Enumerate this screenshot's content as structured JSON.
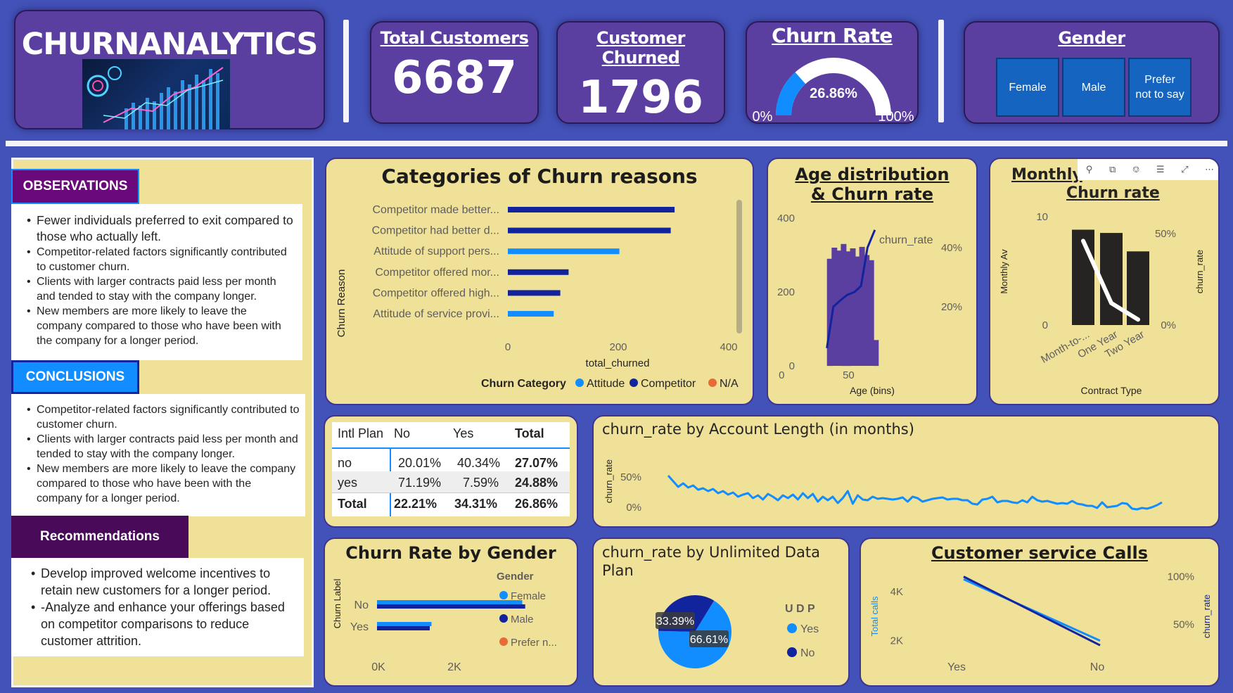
{
  "brand": {
    "title": "CHURNANALYTICS",
    "image_icon": "analytics-dashboard-image"
  },
  "kpis": {
    "total_customers": {
      "label": "Total Customers",
      "value": "6687"
    },
    "customer_churned": {
      "label": "Customer Churned",
      "value": "1796"
    },
    "churn_rate": {
      "label": "Churn Rate",
      "value": "26.86%",
      "fraction": 0.2686,
      "min_label": "0%",
      "max_label": "100%"
    },
    "gender": {
      "label": "Gender",
      "options": [
        "Female",
        "Male",
        "Prefer not to say"
      ]
    }
  },
  "notes": {
    "observations": {
      "label": "OBSERVATIONS",
      "items": [
        "Fewer individuals preferred to exit compared to those who actually left.",
        "Competitor-related factors significantly contributed to customer churn.",
        "Clients with larger contracts paid less per month and tended to stay with the company longer.",
        "New members are more likely to leave the company compared to those who have been with the company for a longer period."
      ]
    },
    "conclusions": {
      "label": "CONCLUSIONS",
      "items": [
        "Competitor-related factors significantly contributed to customer churn.",
        "Clients with larger contracts paid less per month and tended to stay with the company longer.",
        "New members are more likely to leave the company compared to those who have been with the company for a longer period."
      ]
    },
    "recommendations": {
      "label": "Recommendations",
      "items": [
        "Develop improved welcome incentives to retain new customers for a longer period.",
        "-Analyze and enhance your offerings based on competitor comparisons to reduce customer attrition."
      ]
    }
  },
  "colors": {
    "page_bg": "#4352b8",
    "kpi_bg": "#5b3fa0",
    "card_bg": "#f0e199",
    "attitude": "#118dff",
    "competitor": "#12239e",
    "na": "#e66c37",
    "hist_bar": "#5b3fa0",
    "contract_bar": "#252423"
  },
  "visual_header_icons": [
    "pin-icon",
    "copy-icon",
    "bell-icon",
    "filter-icon",
    "focus-mode-icon",
    "more-options-icon"
  ],
  "matrix": {
    "corner": "Intl Plan",
    "columns": [
      "No",
      "Yes",
      "Total"
    ],
    "rows": [
      {
        "label": "no",
        "cells": [
          "20.01%",
          "40.34%",
          "27.07%"
        ]
      },
      {
        "label": "yes",
        "cells": [
          "71.19%",
          "7.59%",
          "24.88%"
        ]
      },
      {
        "label": "Total",
        "cells": [
          "22.21%",
          "34.31%",
          "26.86%"
        ]
      }
    ]
  },
  "chart_data": [
    {
      "id": "churn_reasons",
      "type": "bar",
      "orientation": "horizontal",
      "title": "Categories of Churn reasons",
      "xlabel": "total_churned",
      "ylabel": "Churn Reason",
      "xlim": [
        0,
        400
      ],
      "xticks": [
        "0",
        "200",
        "400"
      ],
      "legend_title": "Churn Category",
      "legend": [
        "Attitude",
        "Competitor",
        "N/A"
      ],
      "categories": [
        "Competitor made better...",
        "Competitor had better d...",
        "Attitude of support pers...",
        "Competitor offered mor...",
        "Competitor offered high...",
        "Attitude of service provi..."
      ],
      "values": [
        302,
        295,
        202,
        110,
        95,
        83
      ],
      "series_of": [
        "Competitor",
        "Competitor",
        "Attitude",
        "Competitor",
        "Competitor",
        "Attitude"
      ]
    },
    {
      "id": "age_churn",
      "type": "bar",
      "title": "Age distribution & Churn rate",
      "xlabel": "Age (bins)",
      "xticks": [
        "0",
        "50"
      ],
      "yticks_left": [
        "0",
        "200",
        "400"
      ],
      "yticks_right": [
        "20%",
        "40%"
      ],
      "ylim_left": [
        0,
        400
      ],
      "series": [
        {
          "type": "bar",
          "x": [
            20,
            25,
            30,
            35,
            40,
            45,
            50,
            55,
            60,
            65,
            70
          ],
          "values": [
            290,
            320,
            312,
            330,
            310,
            318,
            296,
            322,
            300,
            286,
            70
          ]
        },
        {
          "type": "line",
          "name": "churn_rate",
          "x": [
            18,
            25,
            32,
            40,
            48,
            55,
            62,
            70
          ],
          "values": [
            0.06,
            0.2,
            0.22,
            0.24,
            0.25,
            0.27,
            0.4,
            0.46
          ]
        }
      ]
    },
    {
      "id": "contract_churn",
      "type": "bar",
      "title": "Monthly Av... & Churn rate",
      "title_left": "Monthly",
      "title_right": "Churn rate",
      "xlabel": "Contract Type",
      "ylabel_left": "Monthly Av",
      "ylabel_right": "churn_rate",
      "categories": [
        "Month-to-...",
        "One Year",
        "Two Year"
      ],
      "yticks_left": [
        "0",
        "10"
      ],
      "yticks_right": [
        "0%",
        "50%"
      ],
      "ylim_left": [
        0,
        10
      ],
      "ylim_right": [
        0,
        0.5
      ],
      "series": [
        {
          "type": "bar",
          "values": [
            8.8,
            8.5,
            6.8
          ]
        },
        {
          "type": "line",
          "name": "churn_rate",
          "values": [
            0.46,
            0.12,
            0.03
          ]
        }
      ]
    },
    {
      "id": "account_length",
      "type": "line",
      "title": "churn_rate by Account Length (in months)",
      "ylabel": "churn_rate",
      "yticks": [
        "0%",
        "50%"
      ],
      "ylim": [
        0,
        0.8
      ],
      "values": [
        0.52,
        0.44,
        0.36,
        0.41,
        0.35,
        0.38,
        0.32,
        0.34,
        0.3,
        0.33,
        0.27,
        0.3,
        0.25,
        0.28,
        0.22,
        0.25,
        0.27,
        0.2,
        0.24,
        0.18,
        0.26,
        0.22,
        0.17,
        0.24,
        0.2,
        0.25,
        0.18,
        0.27,
        0.2,
        0.26,
        0.15,
        0.22,
        0.17,
        0.22,
        0.13,
        0.2,
        0.3,
        0.12,
        0.24,
        0.18,
        0.17,
        0.22,
        0.19,
        0.2,
        0.19,
        0.18,
        0.19,
        0.21,
        0.15,
        0.22,
        0.2,
        0.15,
        0.17,
        0.19,
        0.2,
        0.21,
        0.18,
        0.19,
        0.19,
        0.17,
        0.17,
        0.12,
        0.11,
        0.18,
        0.19,
        0.22,
        0.14,
        0.16,
        0.16,
        0.14,
        0.13,
        0.17,
        0.14,
        0.22,
        0.17,
        0.15,
        0.16,
        0.14,
        0.12,
        0.13,
        0.12,
        0.16,
        0.12,
        0.11,
        0.09,
        0.09,
        0.06,
        0.14,
        0.07,
        0.08,
        0.09,
        0.13,
        0.12,
        0.05,
        0.04,
        0.06,
        0.05,
        0.07,
        0.1,
        0.14
      ]
    },
    {
      "id": "gender_churn",
      "type": "bar",
      "orientation": "horizontal",
      "title": "Churn Rate by Gender",
      "ylabel": "Churn Label",
      "categories": [
        "No",
        "Yes"
      ],
      "xticks": [
        "0K",
        "2K"
      ],
      "xlim": [
        0,
        2800
      ],
      "legend_title": "Gender",
      "legend": [
        "Female",
        "Male",
        "Prefer n..."
      ],
      "series": [
        {
          "name": "Female",
          "values": [
            2450,
            920
          ]
        },
        {
          "name": "Male",
          "values": [
            2500,
            890
          ]
        }
      ]
    },
    {
      "id": "udp_pie",
      "type": "pie",
      "title": "churn_rate by Unlimited Data Plan",
      "legend_title": "U D P",
      "legend": [
        "Yes",
        "No"
      ],
      "values": [
        0.6661,
        0.3339
      ],
      "labels": [
        "66.61%",
        "33.39%"
      ]
    },
    {
      "id": "service_calls",
      "type": "line",
      "title": "Customer service Calls",
      "ylabel_left": "Total calls",
      "ylabel_right": "churn_rate",
      "categories": [
        "Yes",
        "No"
      ],
      "yticks_left": [
        "2K",
        "4K"
      ],
      "yticks_right": [
        "50%",
        "100%"
      ],
      "ylim_left": [
        1500,
        5000
      ],
      "ylim_right": [
        0.2,
        1.1
      ],
      "series": [
        {
          "name": "Total calls",
          "values": [
            4500,
            2000
          ]
        },
        {
          "name": "churn_rate",
          "values": [
            1.0,
            0.28
          ]
        }
      ]
    }
  ]
}
